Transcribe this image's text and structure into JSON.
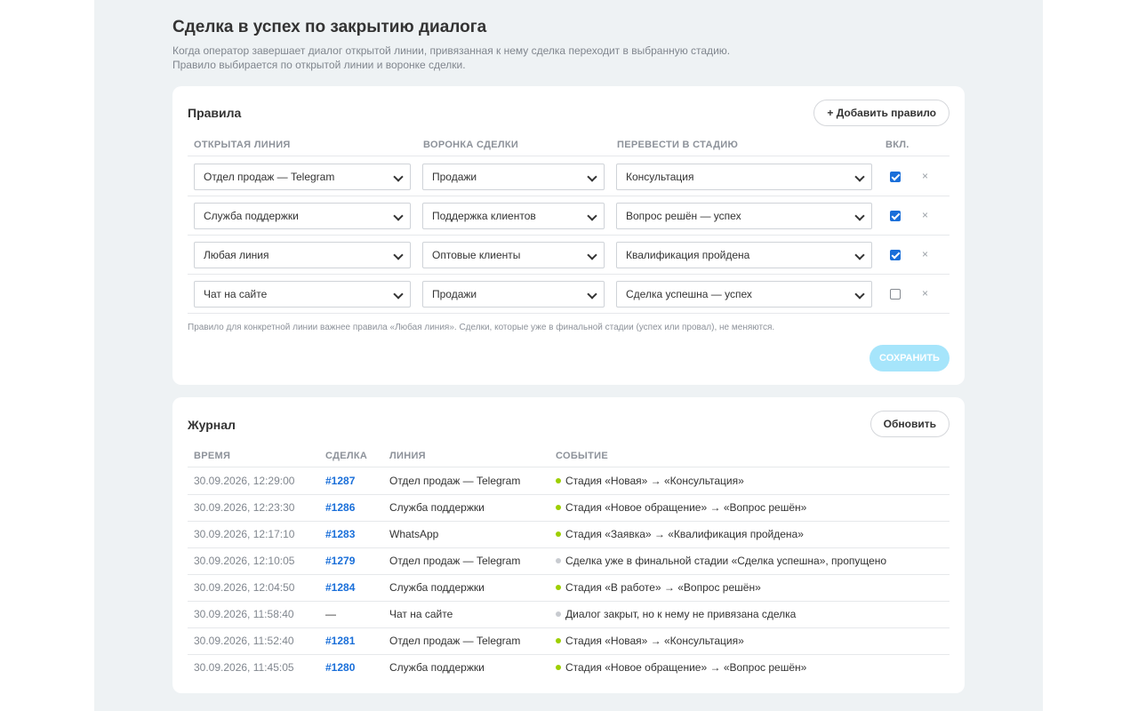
{
  "header": {
    "title": "Сделка в успех по закрытию диалога",
    "description_line1": "Когда оператор завершает диалог открытой линии, привязанная к нему сделка переходит в выбранную стадию.",
    "description_line2": "Правило выбирается по открытой линии и воронке сделки."
  },
  "rules": {
    "title": "Правила",
    "add_button": "+ Добавить правило",
    "columns": {
      "line": "ОТКРЫТАЯ ЛИНИЯ",
      "funnel": "ВОРОНКА СДЕЛКИ",
      "stage": "ПЕРЕВЕСТИ В СТАДИЮ",
      "enabled": "ВКЛ."
    },
    "rows": [
      {
        "line": "Отдел продаж — Telegram",
        "funnel": "Продажи",
        "stage": "Консультация",
        "enabled": true
      },
      {
        "line": "Служба поддержки",
        "funnel": "Поддержка клиентов",
        "stage": "Вопрос решён — успех",
        "enabled": true
      },
      {
        "line": "Любая линия",
        "funnel": "Оптовые клиенты",
        "stage": "Квалификация пройдена",
        "enabled": true
      },
      {
        "line": "Чат на сайте",
        "funnel": "Продажи",
        "stage": "Сделка успешна — успех",
        "enabled": false
      }
    ],
    "remove_glyph": "×",
    "note": "Правило для конкретной линии важнее правила «Любая линия». Сделки, которые уже в финальной стадии (успех или провал), не меняются.",
    "save_button": "СОХРАНИТЬ"
  },
  "log": {
    "title": "Журнал",
    "refresh_button": "Обновить",
    "columns": {
      "time": "ВРЕМЯ",
      "deal": "СДЕЛКА",
      "line": "ЛИНИЯ",
      "event": "СОБЫТИЕ"
    },
    "rows": [
      {
        "time": "30.09.2026, 12:29:00",
        "deal": "#1287",
        "line": "Отдел продаж — Telegram",
        "event": "Стадия «Новая» → «Консультация»",
        "status": "success"
      },
      {
        "time": "30.09.2026, 12:23:30",
        "deal": "#1286",
        "line": "Служба поддержки",
        "event": "Стадия «Новое обращение» → «Вопрос решён»",
        "status": "success"
      },
      {
        "time": "30.09.2026, 12:17:10",
        "deal": "#1283",
        "line": "WhatsApp",
        "event": "Стадия «Заявка» → «Квалификация пройдена»",
        "status": "success"
      },
      {
        "time": "30.09.2026, 12:10:05",
        "deal": "#1279",
        "line": "Отдел продаж — Telegram",
        "event": "Сделка уже в финальной стадии «Сделка успешна», пропущено",
        "status": "skip"
      },
      {
        "time": "30.09.2026, 12:04:50",
        "deal": "#1284",
        "line": "Служба поддержки",
        "event": "Стадия «В работе» → «Вопрос решён»",
        "status": "success"
      },
      {
        "time": "30.09.2026, 11:58:40",
        "deal": "—",
        "line": "Чат на сайте",
        "event": "Диалог закрыт, но к нему не привязана сделка",
        "status": "skip"
      },
      {
        "time": "30.09.2026, 11:52:40",
        "deal": "#1281",
        "line": "Отдел продаж — Telegram",
        "event": "Стадия «Новая» → «Консультация»",
        "status": "success"
      },
      {
        "time": "30.09.2026, 11:45:05",
        "deal": "#1280",
        "line": "Служба поддержки",
        "event": "Стадия «Новое обращение» → «Вопрос решён»",
        "status": "success"
      }
    ]
  },
  "colors": {
    "accent": "#1a6fd9",
    "save_disabled": "#a6e5fb",
    "success_dot": "#9dcf00",
    "skip_dot": "#c8cbd0"
  }
}
